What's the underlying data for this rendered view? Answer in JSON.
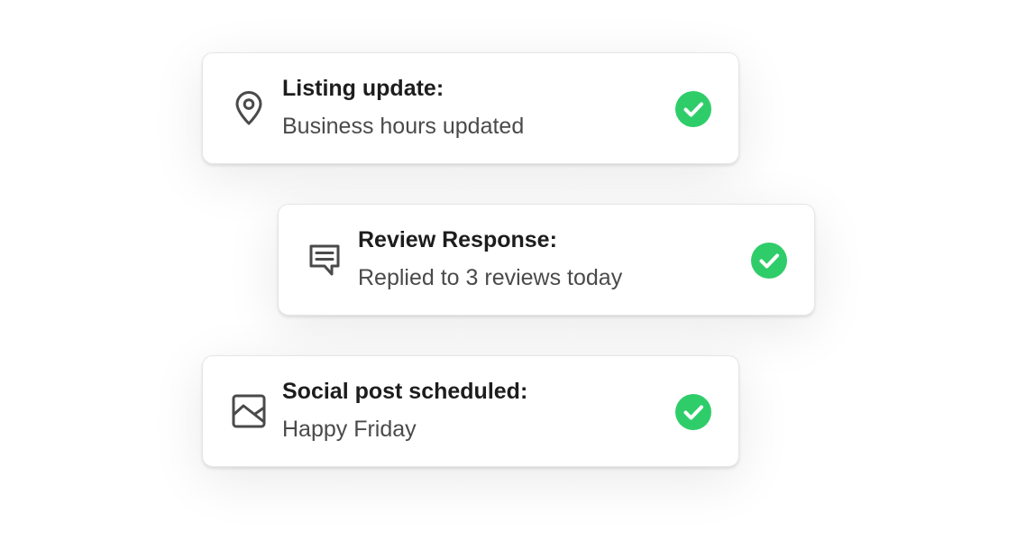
{
  "colors": {
    "success": "#2fcd6a",
    "icon": "#4a4a4a",
    "title": "#1d1d1d",
    "subtitle": "#4a4a4a"
  },
  "cards": [
    {
      "icon": "location-pin-icon",
      "title": "Listing update:",
      "subtitle": "Business hours updated",
      "status_icon": "check-circle-icon"
    },
    {
      "icon": "chat-bubble-icon",
      "title": "Review Response:",
      "subtitle": "Replied to 3 reviews today",
      "status_icon": "check-circle-icon"
    },
    {
      "icon": "image-icon",
      "title": "Social post scheduled:",
      "subtitle": "Happy Friday",
      "status_icon": "check-circle-icon"
    }
  ]
}
